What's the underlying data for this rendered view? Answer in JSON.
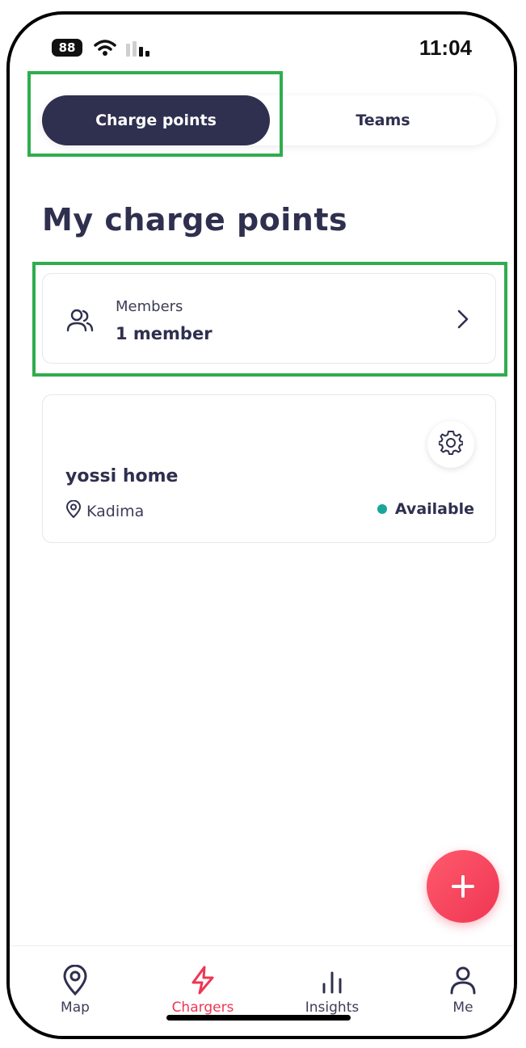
{
  "status_bar": {
    "battery": "88",
    "time": "11:04"
  },
  "tabs": {
    "active": "Charge points",
    "inactive": "Teams"
  },
  "page_title": "My charge points",
  "members": {
    "label": "Members",
    "value": "1 member"
  },
  "charge_point": {
    "name": "yossi home",
    "location": "Kadima",
    "status": "Available",
    "status_color": "#1aa59b"
  },
  "bottom_nav": {
    "map": "Map",
    "chargers": "Chargers",
    "insights": "Insights",
    "me": "Me"
  },
  "colors": {
    "accent": "#ef3652",
    "primary_dark": "#2f2f4f",
    "highlight": "#2fad4e"
  }
}
